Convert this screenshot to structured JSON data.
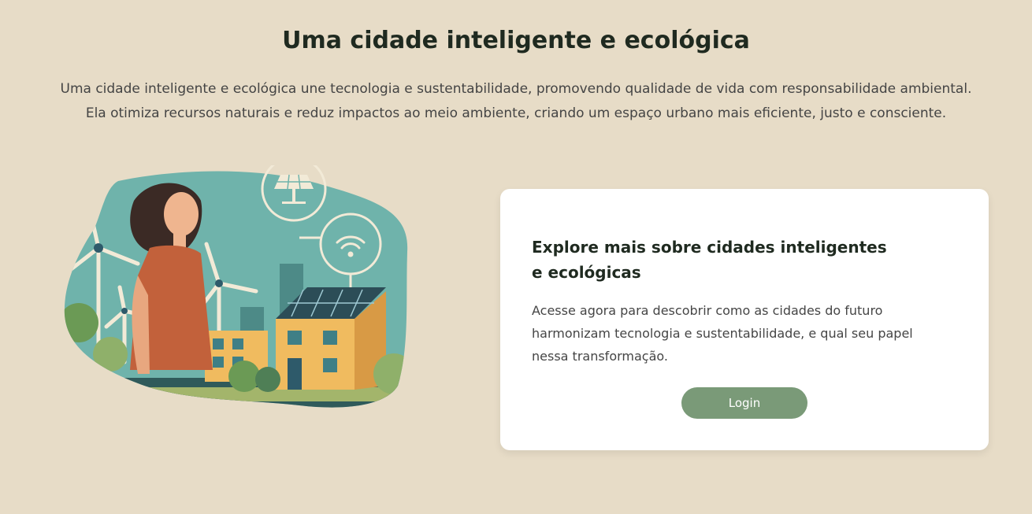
{
  "header": {
    "title": "Uma cidade inteligente e ecológica",
    "intro_line1": "Uma cidade inteligente e ecológica une tecnologia e sustentabilidade, promovendo qualidade de vida com responsabilidade ambiental.",
    "intro_line2": "Ela otimiza recursos naturais e reduz impactos ao meio ambiente, criando um espaço urbano mais eficiente, justo e consciente."
  },
  "illustration": {
    "icon": "woman-smart-city-illustration"
  },
  "card": {
    "title": "Explore mais sobre cidades inteligentes e ecológicas",
    "text": "Acesse agora para descobrir como as cidades do futuro harmonizam tecnologia e sustentabilidade, e qual seu papel nessa transformação.",
    "login_label": "Login"
  },
  "colors": {
    "background": "#e7dcc7",
    "button": "#7a9a78",
    "card": "#ffffff"
  }
}
